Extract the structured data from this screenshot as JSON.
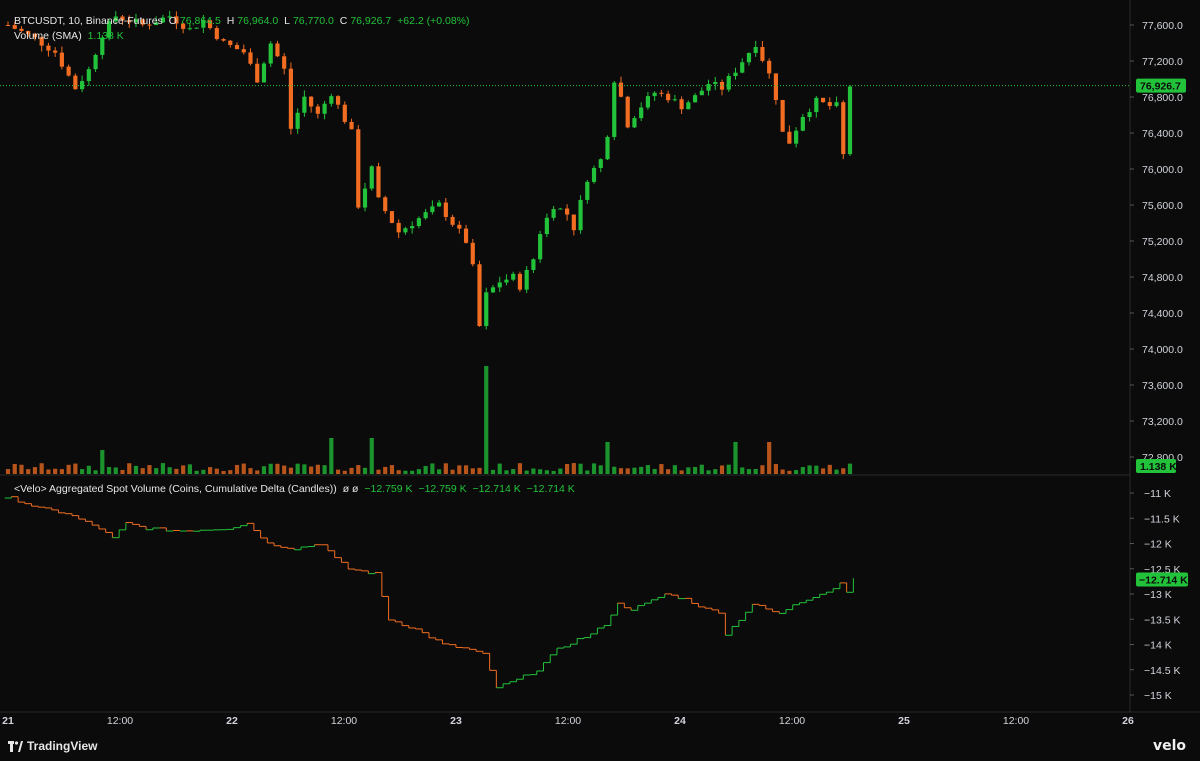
{
  "header": {
    "symbol": "BTCUSDT, 10, Binance-Futures",
    "o_label": "O",
    "o_value": "76,864.5",
    "h_label": "H",
    "h_value": "76,964.0",
    "l_label": "L",
    "l_value": "76,770.0",
    "c_label": "C",
    "c_value": "76,926.7",
    "change": "+62.2 (+0.08%)",
    "volume_label": "Volume (SMA)",
    "volume_value": "1.138 K"
  },
  "indicator": {
    "label": "<Velo> Aggregated Spot Volume (Coins, Cumulative Delta (Candles))",
    "symbols": "ø  ø",
    "values": [
      "−12.759 K",
      "−12.759 K",
      "−12.714 K",
      "−12.714 K"
    ]
  },
  "price_axis": {
    "ticks": [
      "77,600.0",
      "77,200.0",
      "76,800.0",
      "76,400.0",
      "76,000.0",
      "75,600.0",
      "75,200.0",
      "74,800.0",
      "74,400.0",
      "74,000.0",
      "73,600.0",
      "73,200.0",
      "72,800.0"
    ],
    "last_price_label": "76,926.7",
    "volume_badge": "1.138 K"
  },
  "delta_axis": {
    "ticks": [
      "−11 K",
      "−11.5 K",
      "−12 K",
      "−12.5 K",
      "−13 K",
      "−13.5 K",
      "−14 K",
      "−14.5 K",
      "−15 K"
    ],
    "last_label": "−12.714 K"
  },
  "time_axis": {
    "ticks": [
      "21",
      "12:00",
      "22",
      "12:00",
      "23",
      "12:00",
      "24",
      "12:00",
      "25",
      "12:00",
      "26"
    ]
  },
  "brand": {
    "tradingview": "TradingView",
    "velo": "velo"
  },
  "colors": {
    "up": "#22c33a",
    "down": "#f26d21",
    "bg": "#0b0b0b",
    "axis_text": "#d1d4dc"
  },
  "chart_data": {
    "type": "candlestick",
    "symbol": "BTCUSDT",
    "interval": "10",
    "exchange": "Binance-Futures",
    "ylim": [
      72800,
      77800
    ],
    "price_path": [
      [
        0,
        77600
      ],
      [
        4,
        77450
      ],
      [
        7,
        77300
      ],
      [
        10,
        76900
      ],
      [
        12,
        77100
      ],
      [
        14,
        77500
      ],
      [
        16,
        77700
      ],
      [
        20,
        77600
      ],
      [
        24,
        77700
      ],
      [
        27,
        77550
      ],
      [
        29,
        77650
      ],
      [
        32,
        77400
      ],
      [
        35,
        77300
      ],
      [
        37,
        77000
      ],
      [
        39,
        77400
      ],
      [
        41,
        77100
      ],
      [
        42,
        76450
      ],
      [
        44,
        76800
      ],
      [
        46,
        76600
      ],
      [
        48,
        76850
      ],
      [
        51,
        76400
      ],
      [
        52,
        75600
      ],
      [
        54,
        76000
      ],
      [
        55,
        75650
      ],
      [
        58,
        75300
      ],
      [
        60,
        75400
      ],
      [
        62,
        75500
      ],
      [
        64,
        75600
      ],
      [
        66,
        75400
      ],
      [
        68,
        75200
      ],
      [
        69,
        74900
      ],
      [
        70,
        74250
      ],
      [
        71,
        74600
      ],
      [
        73,
        74750
      ],
      [
        75,
        74800
      ],
      [
        76,
        74700
      ],
      [
        78,
        75000
      ],
      [
        79,
        75300
      ],
      [
        81,
        75600
      ],
      [
        83,
        75500
      ],
      [
        84,
        75350
      ],
      [
        86,
        75900
      ],
      [
        88,
        76100
      ],
      [
        89,
        76400
      ],
      [
        90,
        77000
      ],
      [
        91,
        76800
      ],
      [
        92,
        76500
      ],
      [
        94,
        76700
      ],
      [
        96,
        76850
      ],
      [
        98,
        76800
      ],
      [
        100,
        76700
      ],
      [
        102,
        76800
      ],
      [
        104,
        76950
      ],
      [
        106,
        76900
      ],
      [
        108,
        77100
      ],
      [
        110,
        77300
      ],
      [
        111,
        77400
      ],
      [
        113,
        77050
      ],
      [
        114,
        76800
      ],
      [
        115,
        76400
      ],
      [
        116,
        76300
      ],
      [
        118,
        76600
      ],
      [
        120,
        76750
      ],
      [
        122,
        76700
      ],
      [
        123,
        76700
      ],
      [
        124,
        76150
      ],
      [
        125,
        76926.7
      ]
    ],
    "volume_spikes": [
      [
        14,
        "0.6"
      ],
      [
        48,
        "0.9"
      ],
      [
        54,
        "0.9"
      ],
      [
        71,
        "2.7"
      ],
      [
        89,
        "0.8"
      ],
      [
        108,
        "0.8"
      ],
      [
        113,
        "0.8"
      ]
    ],
    "delta_path": [
      [
        0,
        -11.1
      ],
      [
        4,
        -11.3
      ],
      [
        8,
        -11.4
      ],
      [
        13,
        -11.7
      ],
      [
        15,
        -11.9
      ],
      [
        17,
        -11.6
      ],
      [
        20,
        -11.7
      ],
      [
        25,
        -11.75
      ],
      [
        32,
        -11.7
      ],
      [
        35,
        -11.6
      ],
      [
        38,
        -12.0
      ],
      [
        42,
        -12.1
      ],
      [
        46,
        -12.0
      ],
      [
        48,
        -12.3
      ],
      [
        50,
        -12.5
      ],
      [
        54,
        -12.6
      ],
      [
        56,
        -13.5
      ],
      [
        60,
        -13.7
      ],
      [
        64,
        -14.0
      ],
      [
        68,
        -14.1
      ],
      [
        70,
        -14.2
      ],
      [
        72,
        -14.85
      ],
      [
        75,
        -14.7
      ],
      [
        78,
        -14.5
      ],
      [
        81,
        -14.1
      ],
      [
        84,
        -13.9
      ],
      [
        86,
        -13.8
      ],
      [
        88,
        -13.6
      ],
      [
        90,
        -13.2
      ],
      [
        92,
        -13.3
      ],
      [
        94,
        -13.2
      ],
      [
        97,
        -13.0
      ],
      [
        100,
        -13.1
      ],
      [
        103,
        -13.3
      ],
      [
        105,
        -13.35
      ],
      [
        106,
        -13.8
      ],
      [
        108,
        -13.5
      ],
      [
        110,
        -13.2
      ],
      [
        113,
        -13.35
      ],
      [
        114,
        -13.4
      ],
      [
        116,
        -13.2
      ],
      [
        118,
        -13.1
      ],
      [
        120,
        -13.0
      ],
      [
        122,
        -12.9
      ],
      [
        123,
        -12.75
      ],
      [
        124,
        -12.95
      ],
      [
        125,
        -12.714
      ]
    ]
  }
}
